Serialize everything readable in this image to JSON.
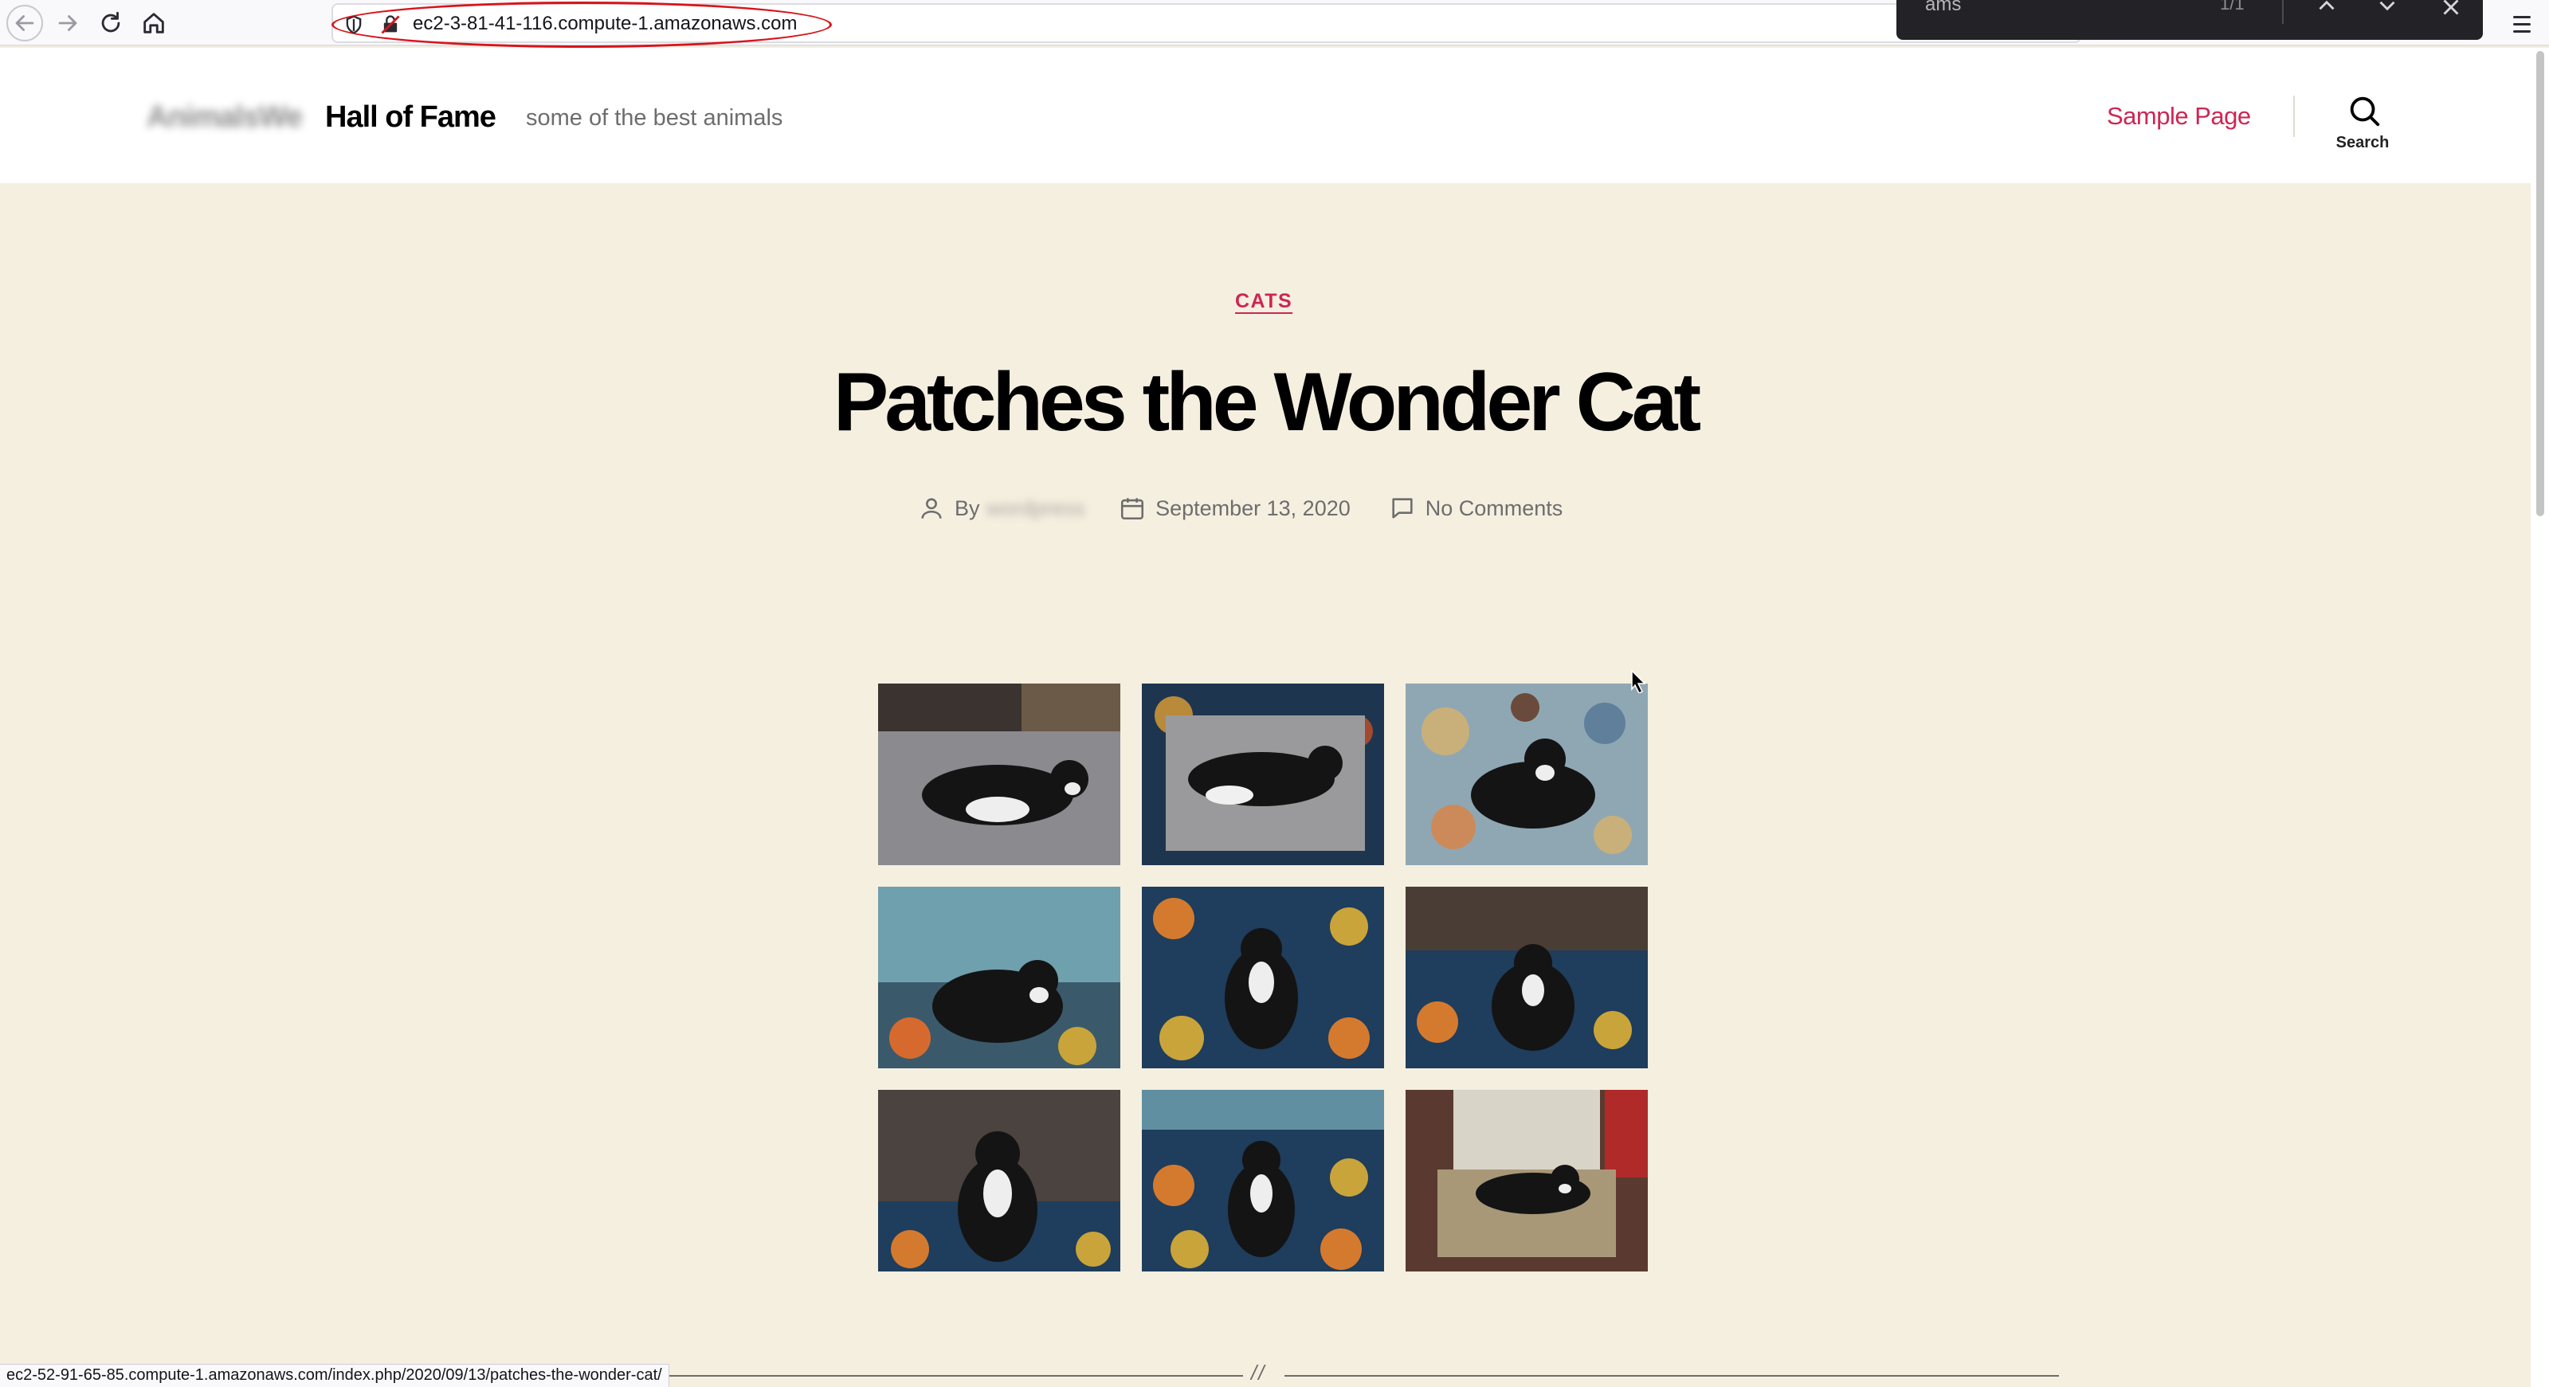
{
  "browser": {
    "url": "ec2-3-81-41-116.compute-1.amazonaws.com",
    "status_url": "ec2-52-91-65-85.compute-1.amazonaws.com/index.php/2020/09/13/patches-the-wonder-cat/",
    "find_text": "ams",
    "find_count": "1/1",
    "highlight_color": "#d8141b"
  },
  "site": {
    "title_blurred": "AnimalsWe",
    "title": "Hall of Fame",
    "tagline": "some of the best animals",
    "nav": [
      {
        "label": "Sample Page"
      }
    ],
    "search_label": "Search",
    "accent_color": "#cd2653",
    "background_color": "#f5efe0"
  },
  "post": {
    "category": "CATS",
    "title": "Patches the Wonder Cat",
    "by": "By",
    "author_blurred": "wordpress",
    "date": "September 13, 2020",
    "comments": "No Comments"
  },
  "gallery": {
    "images": [
      {
        "name": "cat-on-gray-couch"
      },
      {
        "name": "cat-on-cushion"
      },
      {
        "name": "cat-on-floral-chair"
      },
      {
        "name": "cat-on-rug-by-dresser"
      },
      {
        "name": "cat-sitting-on-rug"
      },
      {
        "name": "cat-on-rug-by-sofa"
      },
      {
        "name": "cat-sitting-by-recliner"
      },
      {
        "name": "cat-sitting-on-rug-2"
      },
      {
        "name": "cat-on-armchair"
      }
    ]
  },
  "footer": {
    "separator_mark": "//"
  }
}
